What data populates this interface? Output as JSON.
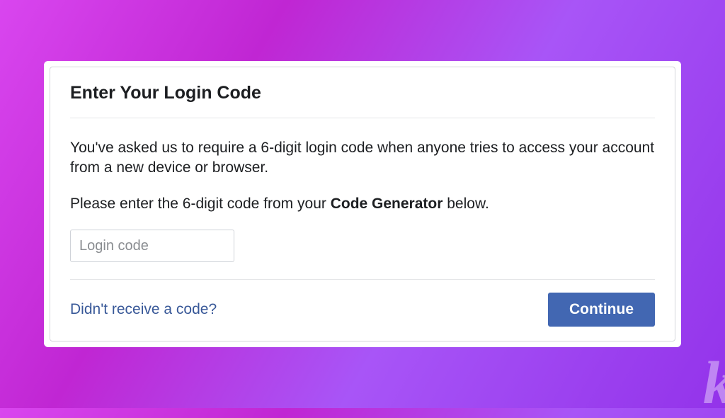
{
  "dialog": {
    "title": "Enter Your Login Code",
    "description1": "You've asked us to require a 6-digit login code when anyone tries to access your account from a new device or browser.",
    "description2_prefix": "Please enter the 6-digit code from your ",
    "description2_bold": "Code Generator",
    "description2_suffix": " below.",
    "input_placeholder": "Login code",
    "input_value": "",
    "help_link": "Didn't receive a code?",
    "continue_button": "Continue"
  }
}
